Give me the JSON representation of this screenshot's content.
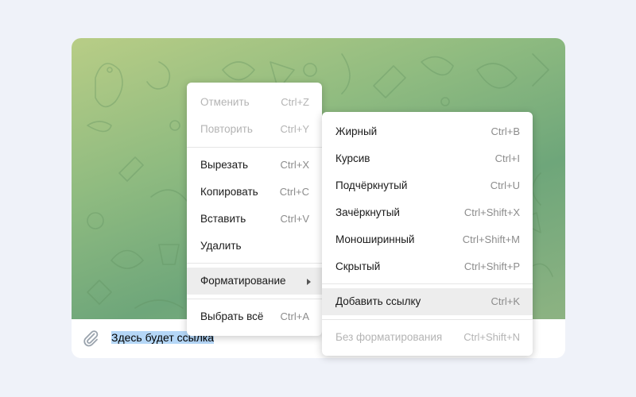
{
  "input": {
    "text": "Здесь будет ссылка"
  },
  "icons": {
    "attach": "paperclip-icon",
    "submenu": "chevron-right-icon"
  },
  "colors": {
    "background": "#eff2f9",
    "selection": "#b5d7f7",
    "hover": "#ededed"
  },
  "context_menu": {
    "undo": {
      "label": "Отменить",
      "shortcut": "Ctrl+Z"
    },
    "redo": {
      "label": "Повторить",
      "shortcut": "Ctrl+Y"
    },
    "cut": {
      "label": "Вырезать",
      "shortcut": "Ctrl+X"
    },
    "copy": {
      "label": "Копировать",
      "shortcut": "Ctrl+C"
    },
    "paste": {
      "label": "Вставить",
      "shortcut": "Ctrl+V"
    },
    "delete": {
      "label": "Удалить"
    },
    "formatting": {
      "label": "Форматирование"
    },
    "select_all": {
      "label": "Выбрать всё",
      "shortcut": "Ctrl+A"
    }
  },
  "format_menu": {
    "bold": {
      "label": "Жирный",
      "shortcut": "Ctrl+B"
    },
    "italic": {
      "label": "Курсив",
      "shortcut": "Ctrl+I"
    },
    "underline": {
      "label": "Подчёркнутый",
      "shortcut": "Ctrl+U"
    },
    "strikethrough": {
      "label": "Зачёркнутый",
      "shortcut": "Ctrl+Shift+X"
    },
    "monospace": {
      "label": "Моноширинный",
      "shortcut": "Ctrl+Shift+M"
    },
    "spoiler": {
      "label": "Скрытый",
      "shortcut": "Ctrl+Shift+P"
    },
    "add_link": {
      "label": "Добавить ссылку",
      "shortcut": "Ctrl+K"
    },
    "clear": {
      "label": "Без форматирования",
      "shortcut": "Ctrl+Shift+N"
    }
  }
}
